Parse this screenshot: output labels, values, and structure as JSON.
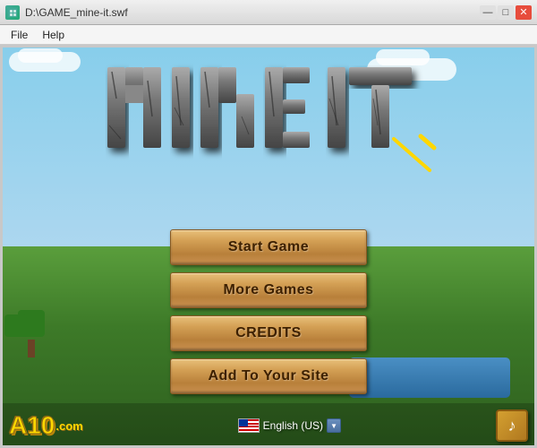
{
  "window": {
    "title": "D:\\GAME_mine-it.swf",
    "icon_label": "swf-icon"
  },
  "menubar": {
    "items": [
      "File",
      "Help"
    ]
  },
  "game": {
    "title_line1": "MINE IT",
    "buttons": [
      {
        "id": "start-game",
        "label": "Start Game"
      },
      {
        "id": "more-games",
        "label": "More Games"
      },
      {
        "id": "credits",
        "label": "CREDITS"
      },
      {
        "id": "add-to-site",
        "label": "Add To Your Site"
      }
    ]
  },
  "bottom": {
    "logo": "A10",
    "logo_suffix": ".com",
    "language": "English (US)",
    "music_icon": "♪"
  },
  "titlebar_buttons": {
    "minimize": "—",
    "maximize": "□",
    "close": "✕"
  }
}
